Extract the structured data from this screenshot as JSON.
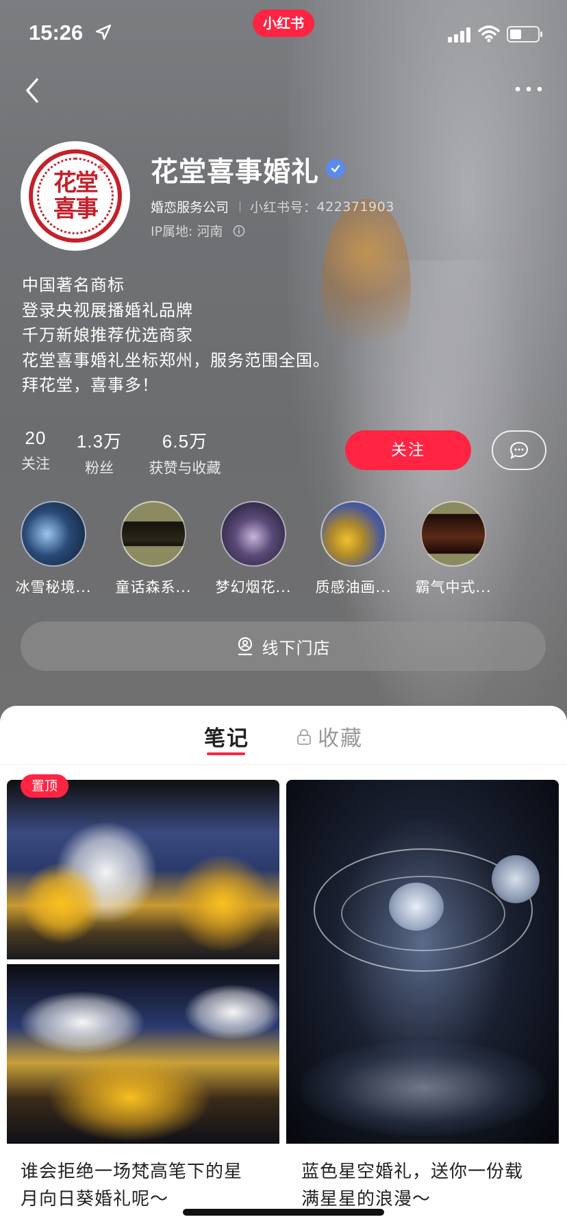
{
  "status_bar": {
    "time": "15:26",
    "brand": "小红书"
  },
  "profile": {
    "name": "花堂喜事婚礼",
    "avatar_text": "花堂喜事",
    "category": "婚恋服务公司",
    "red_id_label": "小红书号：",
    "red_id": "422371903",
    "ip_label": "IP属地: 河南",
    "bio": [
      "中国著名商标",
      "登录央视展播婚礼品牌",
      "千万新娘推荐优选商家",
      "花堂喜事婚礼坐标郑州，服务范围全国。",
      "拜花堂，喜事多！"
    ]
  },
  "stats": [
    {
      "num": "20",
      "label": "关注"
    },
    {
      "num": "1.3万",
      "label": "粉丝"
    },
    {
      "num": "6.5万",
      "label": "获赞与收藏"
    }
  ],
  "actions": {
    "follow": "关注",
    "store": "线下门店"
  },
  "collections": [
    {
      "label": "冰雪秘境...",
      "color": "#2a4a78"
    },
    {
      "label": "童话森系...",
      "color": "#3a3a2a"
    },
    {
      "label": "梦幻烟花...",
      "color": "#3a3550"
    },
    {
      "label": "质感油画...",
      "color": "#4a5a9a"
    },
    {
      "label": "霸气中式...",
      "color": "#3a1a12"
    }
  ],
  "tabs": {
    "notes": "笔记",
    "favorites": "收藏"
  },
  "notes": [
    {
      "pinned": "置顶",
      "title_line1": "谁会拒绝一场梵高笔下的星",
      "title_line2": "月向日葵婚礼呢～"
    },
    {
      "title_line1": "蓝色星空婚礼，送你一份载",
      "title_line2": "满星星的浪漫～"
    }
  ],
  "colors": {
    "accent": "#ff2442",
    "verified": "#5b8bf0"
  }
}
